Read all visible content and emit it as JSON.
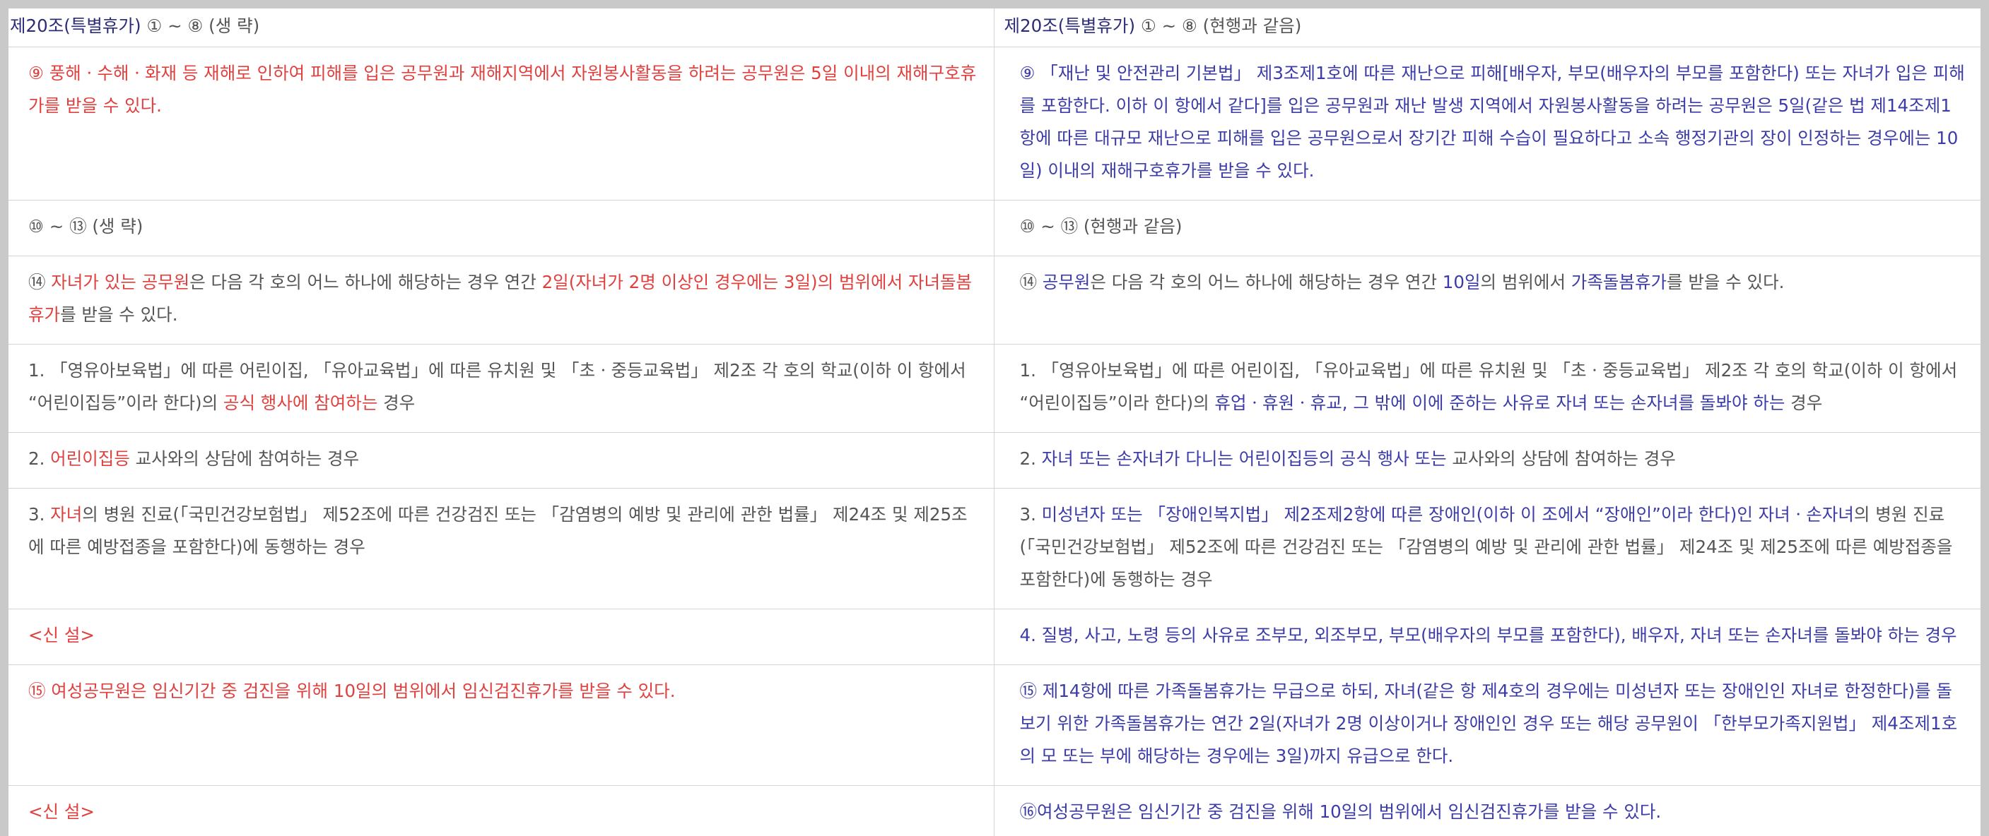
{
  "header": {
    "left": {
      "article": "제20조(특별휴가)",
      "text": " ① ~ ⑧ (생 략)"
    },
    "right": {
      "article": "제20조(특별휴가)",
      "text": " ① ~ ⑧ (현행과 같음)"
    }
  },
  "rows": [
    {
      "left": [
        {
          "t": "⑨ 풍해ㆍ수해ㆍ화재 등 재해로 인하여 피해를 입은 공무원과 재해지역에서 자원봉사활동을 하려는 공무원은 5일 이내의 재해구호휴가를 받을 수 있다.",
          "c": "red"
        }
      ],
      "right": [
        {
          "t": "⑨ 「재난 및 안전관리 기본법」 제3조제1호에 따른 재난으로 피해[배우자, 부모(배우자의 부모를 포함한다) 또는 자녀가 입은 피해를 포함한다. 이하 이 항에서 같다]를 입은 공무원과 재난 발생 지역에서 자원봉사활동을 하려는 공무원은 5일(같은 법 제14조제1항에 따른 대규모 재난으로 피해를 입은 공무원으로서 장기간 피해 수습이 필요하다고 소속 행정기관의 장이 인정하는 경우에는 10일) 이내의 재해구호휴가를 받을 수 있다.",
          "c": "blue"
        }
      ]
    },
    {
      "left": [
        {
          "t": "⑩ ~ ⑬ (생 략)",
          "c": "gray"
        }
      ],
      "right": [
        {
          "t": "⑩ ~ ⑬ (현행과 같음)",
          "c": "gray"
        }
      ]
    },
    {
      "left": [
        {
          "t": "⑭ ",
          "c": "gray"
        },
        {
          "t": "자녀가 있는 공무원",
          "c": "red"
        },
        {
          "t": "은 다음 각 호의 어느 하나에 해당하는 경우 연간 ",
          "c": "gray"
        },
        {
          "t": "2일(자녀가 2명 이상인 경우에는 3일)",
          "c": "red"
        },
        {
          "t": "의 범위에서 ",
          "c": "red"
        },
        {
          "t": "자녀돌봄휴가",
          "c": "red"
        },
        {
          "t": "를 받을 수 있다.",
          "c": "gray"
        }
      ],
      "right": [
        {
          "t": "⑭ ",
          "c": "gray"
        },
        {
          "t": "공무원",
          "c": "blue"
        },
        {
          "t": "은 다음 각 호의 어느 하나에 해당하는 경우 연간 ",
          "c": "gray"
        },
        {
          "t": "10일",
          "c": "blue"
        },
        {
          "t": "의 범위에서 ",
          "c": "gray"
        },
        {
          "t": "가족돌봄휴가",
          "c": "blue"
        },
        {
          "t": "를 받을 수 있다.",
          "c": "gray"
        }
      ]
    },
    {
      "left": [
        {
          "t": "1. 「영유아보육법」에 따른 어린이집, 「유아교육법」에 따른 유치원 및 「초ㆍ중등교육법」 제2조 각 호의 학교(이하 이 항에서 “어린이집등”이라 한다)의 ",
          "c": "gray"
        },
        {
          "t": "공식 행사에 참여하는",
          "c": "red"
        },
        {
          "t": " 경우",
          "c": "gray"
        }
      ],
      "right": [
        {
          "t": "1. 「영유아보육법」에 따른 어린이집, 「유아교육법」에 따른 유치원 및 「초ㆍ중등교육법」 제2조 각 호의 학교(이하 이 항에서 “어린이집등”이라 한다)의 ",
          "c": "gray"
        },
        {
          "t": "휴업ㆍ휴원ㆍ휴교, 그 밖에 이에 준하는 사유로 자녀 또는 손자녀를 돌봐야 하는",
          "c": "blue"
        },
        {
          "t": " 경우",
          "c": "gray"
        }
      ]
    },
    {
      "left": [
        {
          "t": "2. ",
          "c": "gray"
        },
        {
          "t": "어린이집등",
          "c": "red"
        },
        {
          "t": " 교사와의 상담에 참여하는 경우",
          "c": "gray"
        }
      ],
      "right": [
        {
          "t": "2. ",
          "c": "gray"
        },
        {
          "t": "자녀 또는 손자녀가 다니는 어린이집등의 공식 행사 또는",
          "c": "blue"
        },
        {
          "t": " 교사와의 상담에 참여하는 경우",
          "c": "gray"
        }
      ]
    },
    {
      "left": [
        {
          "t": "3. ",
          "c": "gray"
        },
        {
          "t": "자녀",
          "c": "red"
        },
        {
          "t": "의 병원 진료(「국민건강보험법」 제52조에 따른 건강검진 또는 「감염병의 예방 및 관리에 관한 법률」 제24조 및 제25조에 따른 예방접종을 포함한다)에 동행하는 경우",
          "c": "gray"
        }
      ],
      "right": [
        {
          "t": "3. ",
          "c": "gray"
        },
        {
          "t": "미성년자 또는 「장애인복지법」 제2조제2항에 따른 장애인(이하 이 조에서 “장애인”이라 한다)인 자녀ㆍ손자녀",
          "c": "blue"
        },
        {
          "t": "의 병원 진료(「국민건강보험법」 제52조에 따른 건강검진 또는 「감염병의 예방 및 관리에 관한 법률」 제24조 및 제25조에 따른 예방접종을 포함한다)에 동행하는 경우",
          "c": "gray"
        }
      ]
    },
    {
      "left": [
        {
          "t": "<신 설>",
          "c": "red"
        }
      ],
      "right": [
        {
          "t": "4. 질병, 사고, 노령 등의 사유로 조부모, 외조부모, 부모(배우자의 부모를 포함한다), 배우자, 자녀 또는 손자녀를 돌봐야 하는 경우",
          "c": "blue"
        }
      ]
    },
    {
      "left": [
        {
          "t": "⑮ 여성공무원은 임신기간 중 검진을 위해 10일의 범위에서 임신검진휴가를 받을 수 있다.",
          "c": "red"
        }
      ],
      "right": [
        {
          "t": "⑮ 제14항에 따른 가족돌봄휴가는 무급으로 하되, 자녀(같은 항 제4호의 경우에는 미성년자 또는 장애인인 자녀로 한정한다)를 돌보기 위한 가족돌봄휴가는 연간 2일(자녀가 2명 이상이거나 장애인인 경우 또는 해당 공무원이 「한부모가족지원법」 제4조제1호의 모 또는 부에 해당하는 경우에는 3일)까지 유급으로 한다.",
          "c": "blue"
        }
      ]
    },
    {
      "left": [
        {
          "t": "<신 설>",
          "c": "red"
        }
      ],
      "right": [
        {
          "t": "⑯여성공무원은 임신기간 중 검진을 위해 10일의 범위에서 임신검진휴가를 받을 수 있다.",
          "c": "blue"
        }
      ]
    }
  ]
}
